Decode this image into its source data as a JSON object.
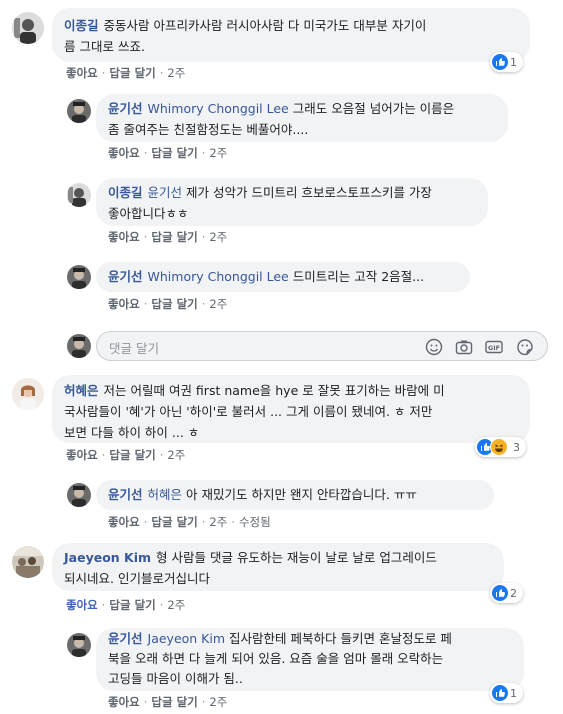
{
  "actions": {
    "like": "좋아요",
    "reply": "답글 달기",
    "edited": "수정됨"
  },
  "comments": [
    {
      "author": "이종길",
      "text_line1": "중동사람 아프리카사람 러시아사람 다 미국가도 대부분 자기이",
      "text_line2": "름 그대로 쓰죠.",
      "time": "2주",
      "reaction_count": "1"
    },
    {
      "author": "윤기선",
      "mention": "Whimory Chonggil Lee",
      "text_line1": "그래도 오음절 넘어가는 이름은",
      "text_line2": "좀 줄여주는 친절함정도는 베풀어야....",
      "time": "2주"
    },
    {
      "author": "이종길",
      "mention": "윤기선",
      "text_line1": "제가 성악가 드미트리 흐보로스토프스키를 가장",
      "text_line2": "좋아합니다ㅎㅎ",
      "time": "2주"
    },
    {
      "author": "윤기선",
      "mention": "Whimory Chonggil Lee",
      "text_line1": "드미트리는 고작 2음절...",
      "time": "2주"
    },
    {
      "author": "허혜은",
      "text_line1": "저는 어릴때 여권 first name을 hye 로 잘못 표기하는 바람에 미",
      "text_line2": "국사람들이 '혜'가 아닌 '하이'로 불러서 ... 그게 이름이 됐네여. ㅎ 저만",
      "text_line3": "보면 다들 하이 하이 ... ㅎ",
      "time": "2주",
      "reaction_count": "3"
    },
    {
      "author": "윤기선",
      "mention": "허혜은",
      "text_line1": "아 재밌기도 하지만 왠지 안타깝습니다. ㅠㅠ",
      "time": "2주"
    },
    {
      "author": "Jaeyeon Kim",
      "text_line1": "형 사람들 댓글 유도하는 재능이 날로 날로 업그레이드",
      "text_line2": "되시네요. 인기블로거십니다",
      "time": "2주",
      "reaction_count": "2"
    },
    {
      "author": "윤기선",
      "mention": "Jaeyeon Kim",
      "text_line1": "집사람한테 페북하다 들키면 혼날정도로 페",
      "text_line2": "북을 오래 하면 다 늘게 되어 있음. 요즘 술을 엄마 몰래 오락하는",
      "text_line3": "고딩들 마음이 이해가 됨..",
      "time": "2주",
      "reaction_count": "1"
    }
  ],
  "reply_box": {
    "placeholder": "댓글 달기"
  },
  "icons": [
    "emoji-icon",
    "camera-icon",
    "gif-icon",
    "sticker-icon",
    "like-reaction-icon",
    "haha-reaction-icon"
  ],
  "colors": {
    "author": "#385898",
    "bubble": "#f2f3f5",
    "like": "#1877f2"
  }
}
